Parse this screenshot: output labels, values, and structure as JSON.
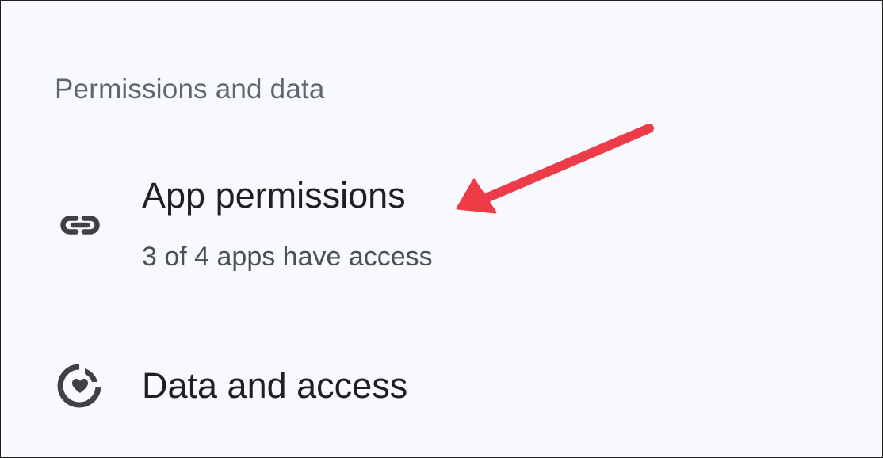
{
  "section": {
    "header": "Permissions and data"
  },
  "items": [
    {
      "title": "App permissions",
      "subtitle": "3 of 4 apps have access",
      "icon": "link-icon"
    },
    {
      "title": "Data and access",
      "icon": "health-data-icon"
    }
  ],
  "colors": {
    "background": "#f8f9fd",
    "icon": "#3f4146",
    "header_text": "#5f6671",
    "title_text": "#1d1f24",
    "subtitle_text": "#4a4f57",
    "annotation_arrow": "#ee3b48"
  }
}
